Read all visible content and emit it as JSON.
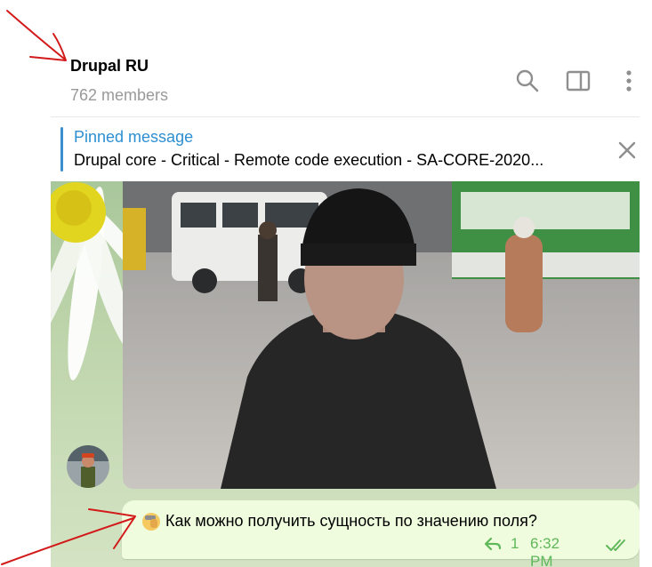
{
  "header": {
    "title": "Drupal RU",
    "members": "762 members",
    "icons": [
      "search-icon",
      "sidebar-toggle-icon",
      "more-vertical-icon"
    ]
  },
  "pinned": {
    "label": "Pinned message",
    "text": "Drupal core - Critical - Remote code execution - SA-CORE-2020...",
    "close_icon": "close-icon"
  },
  "message": {
    "emoji": "🤦",
    "text": "Как можно получить сущность по значению поля?",
    "reply_count": "1",
    "time": "6:32 PM",
    "status_icon": "double-check-icon"
  },
  "colors": {
    "accent": "#2d8fd1",
    "bubble": "#effdde",
    "meta": "#5fb85a",
    "annotation": "#d21a1a"
  }
}
